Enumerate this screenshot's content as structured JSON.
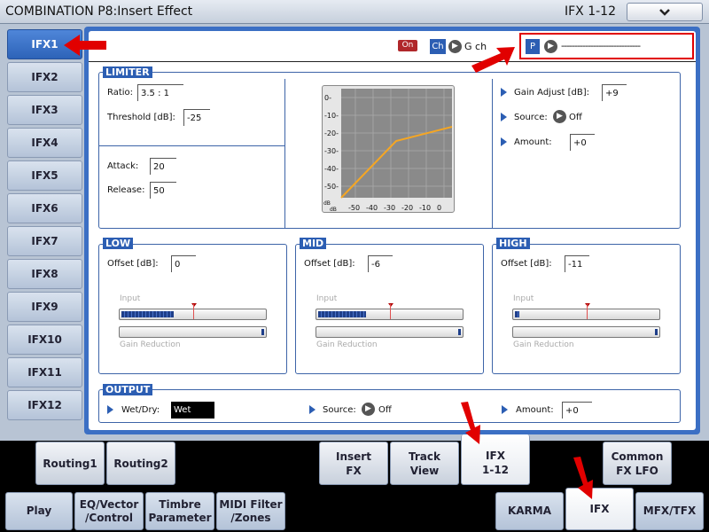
{
  "title": {
    "text": "COMBINATION P8:Insert Effect",
    "right": "IFX 1-12",
    "dropdown_icon": "chevron-down-icon"
  },
  "ifx_tabs": [
    "IFX1",
    "IFX2",
    "IFX3",
    "IFX4",
    "IFX5",
    "IFX6",
    "IFX7",
    "IFX8",
    "IFX9",
    "IFX10",
    "IFX11",
    "IFX12"
  ],
  "header": {
    "on_label": "On",
    "ch_label": "Ch",
    "ch_value": "G ch",
    "p_label": "P",
    "p_value": "------------------------------"
  },
  "limiter": {
    "label": "LIMITER",
    "ratio_label": "Ratio:",
    "ratio_value": "3.5 : 1",
    "threshold_label": "Threshold [dB]:",
    "threshold_value": "-25",
    "attack_label": "Attack:",
    "attack_value": "20",
    "release_label": "Release:",
    "release_value": "50",
    "gain_adjust_label": "Gain Adjust [dB]:",
    "gain_adjust_value": "+9",
    "source_label": "Source:",
    "source_value": "Off",
    "amount_label": "Amount:",
    "amount_value": "+0"
  },
  "graph": {
    "y_ticks": [
      "0-",
      "-10-",
      "-20-",
      "-30-",
      "-40-",
      "-50-"
    ],
    "x_ticks": [
      "-50",
      "-40",
      "-30",
      "-20",
      "-10",
      "0"
    ],
    "unit": "dB"
  },
  "bands": [
    {
      "label": "LOW",
      "offset_label": "Offset [dB]:",
      "offset_value": "0",
      "input_label": "Input",
      "gr_label": "Gain Reduction",
      "input_level": 0.37
    },
    {
      "label": "MID",
      "offset_label": "Offset [dB]:",
      "offset_value": "-6",
      "input_label": "Input",
      "gr_label": "Gain Reduction",
      "input_level": 0.34
    },
    {
      "label": "HIGH",
      "offset_label": "Offset [dB]:",
      "offset_value": "-11",
      "input_label": "Input",
      "gr_label": "Gain Reduction",
      "input_level": 0.03
    }
  ],
  "output": {
    "label": "OUTPUT",
    "wetdry_label": "Wet/Dry:",
    "wetdry_value": "Wet",
    "source_label": "Source:",
    "source_value": "Off",
    "amount_label": "Amount:",
    "amount_value": "+0"
  },
  "subtabs": {
    "routing1": "Routing1",
    "routing2": "Routing2",
    "insert_fx_1": "Insert",
    "insert_fx_2": "FX",
    "track_view_1": "Track",
    "track_view_2": "View",
    "ifx_1": "IFX",
    "ifx_2": "1-12",
    "common_lfo_1": "Common",
    "common_lfo_2": "FX LFO"
  },
  "nav": {
    "play": "Play",
    "eq_1": "EQ/Vector",
    "eq_2": "/Control",
    "timbre_1": "Timbre",
    "timbre_2": "Parameter",
    "midi_1": "MIDI Filter",
    "midi_2": "/Zones",
    "karma": "KARMA",
    "ifx": "IFX",
    "mfx": "MFX/TFX"
  },
  "colors": {
    "accent": "#2c5eb3",
    "panel": "#3b6fc4",
    "annotation": "#e10000",
    "curve": "#f5a623"
  }
}
